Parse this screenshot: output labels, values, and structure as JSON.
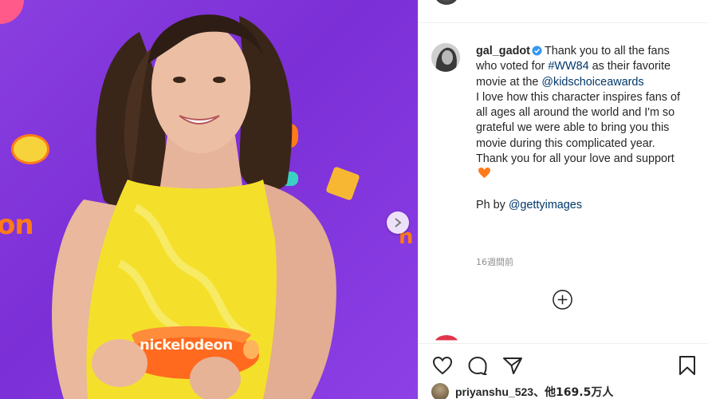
{
  "post": {
    "photo": {
      "background_color": "#7b2fd6",
      "dress_color": "#f4e02a",
      "trophy_color": "#ff6a1f",
      "trophy_text": "nickelodeon",
      "backdrop_text": "on",
      "backdrop_text_right": "n",
      "next_icon": "chevron-right-icon"
    },
    "caption": {
      "username": "gal_gadot",
      "verified_icon": "verified-badge-icon",
      "line1": "Thank you to all the fans who voted for",
      "hashtag": "#WW84",
      "line2": "as their favorite movie at the",
      "mention": "@kidschoiceawards",
      "paragraph": "I love how this character inspires fans of all ages all around the world and I'm so grateful we were able to bring you this movie during this complicated year.",
      "thanks": "Thank you for all your love and support",
      "heart_icon": "orange-heart-icon",
      "credit_prefix": "Ph by",
      "credit_mention": "@gettyimages"
    },
    "timestamp": "16週間前",
    "load_more_icon": "plus-circle-icon",
    "actions": {
      "like_icon": "heart-icon",
      "comment_icon": "comment-icon",
      "share_icon": "share-icon",
      "save_icon": "bookmark-icon"
    },
    "likes": {
      "username": "priyanshu_523",
      "separator": "、",
      "others": "他169.5万人"
    },
    "colors": {
      "link": "#00376b",
      "verified": "#3897f0",
      "text": "#262626",
      "muted": "#8e8e8e"
    }
  }
}
